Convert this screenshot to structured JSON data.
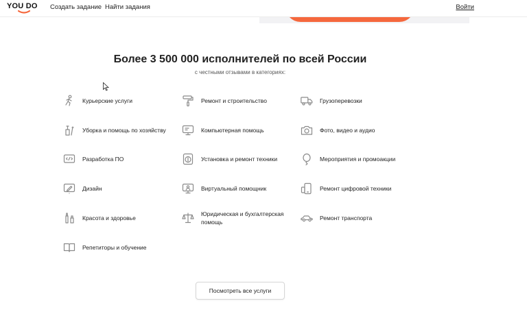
{
  "header": {
    "logo_text": "YOU DO",
    "nav": [
      {
        "label": "Создать задание"
      },
      {
        "label": "Найти задания"
      }
    ],
    "login_label": "Войти"
  },
  "colors": {
    "accent": "#f5683d",
    "icon": "#8a8a8a"
  },
  "main": {
    "title": "Более 3 500 000 исполнителей по всей России",
    "subtitle": "с честными отзывами в категориях:",
    "categories": [
      {
        "label": "Курьерские услуги",
        "icon": "courier-icon"
      },
      {
        "label": "Ремонт и строительство",
        "icon": "paint-roller-icon"
      },
      {
        "label": "Грузоперевозки",
        "icon": "truck-icon"
      },
      {
        "label": "Уборка и помощь по хозяйству",
        "icon": "cleaning-icon"
      },
      {
        "label": "Компьютерная помощь",
        "icon": "monitor-icon"
      },
      {
        "label": "Фото, видео и аудио",
        "icon": "camera-icon"
      },
      {
        "label": "Разработка ПО",
        "icon": "code-icon"
      },
      {
        "label": "Установка и ремонт техники",
        "icon": "appliance-icon"
      },
      {
        "label": "Мероприятия и промоакции",
        "icon": "balloon-icon"
      },
      {
        "label": "Дизайн",
        "icon": "design-icon"
      },
      {
        "label": "Виртуальный помощник",
        "icon": "assistant-icon"
      },
      {
        "label": "Ремонт цифровой техники",
        "icon": "devices-icon"
      },
      {
        "label": "Красота и здоровье",
        "icon": "beauty-icon"
      },
      {
        "label": "Юридическая и бухгалтерская помощь",
        "icon": "scales-icon"
      },
      {
        "label": "Ремонт транспорта",
        "icon": "car-icon"
      },
      {
        "label": "Репетиторы и обучение",
        "icon": "book-icon"
      }
    ],
    "view_all_label": "Посмотреть все услуги"
  }
}
